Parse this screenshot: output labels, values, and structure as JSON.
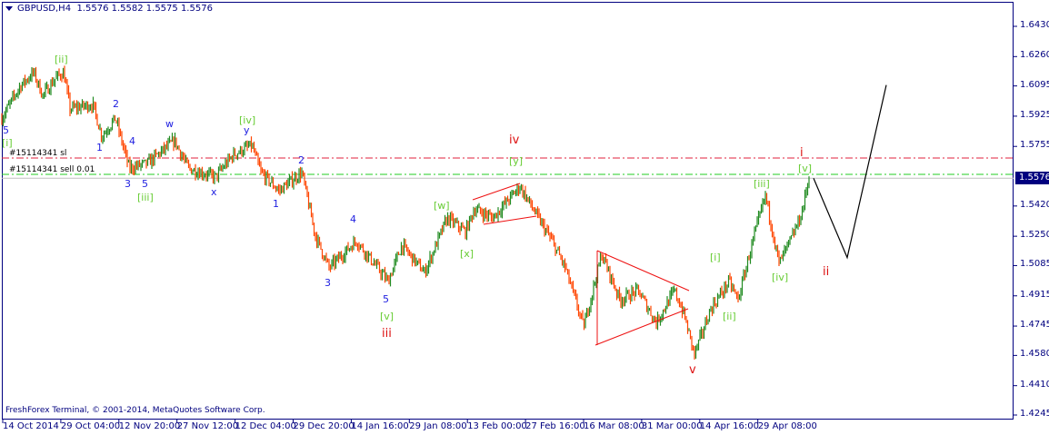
{
  "header": {
    "symbol": "GBPUSD,H4",
    "ohlc": "1.5576 1.5582 1.5575 1.5576"
  },
  "copyright": "FreshForex Terminal, © 2001-2014, MetaQuotes Software Corp.",
  "current_price": "1.5576",
  "orders": {
    "sl_label": "#15114341 sl",
    "sell_label": "#15114341 sell 0.01",
    "sl_price": 1.569,
    "sell_price": 1.5598
  },
  "y_axis": [
    "1.6430",
    "1.6260",
    "1.6095",
    "1.5925",
    "1.5755",
    "1.5420",
    "1.5250",
    "1.5085",
    "1.4915",
    "1.4745",
    "1.4580",
    "1.4410",
    "1.4245"
  ],
  "x_axis": [
    "14 Oct 2014",
    "29 Oct 04:00",
    "12 Nov 20:00",
    "27 Nov 12:00",
    "12 Dec 04:00",
    "29 Dec 20:00",
    "14 Jan 16:00",
    "29 Jan 08:00",
    "13 Feb 00:00",
    "27 Feb 16:00",
    "16 Mar 08:00",
    "31 Mar 00:00",
    "14 Apr 16:00",
    "29 Apr 08:00"
  ],
  "colors": {
    "up": "#228b22",
    "down": "#ff4500",
    "sl": "#e0203c",
    "sell": "#22cc22",
    "axis": "#00007f",
    "primary": "#dd1111",
    "minor": "#1e1ee0",
    "inter": "#66cc33"
  },
  "wave_labels": [
    {
      "t": "5",
      "c": "minor"
    },
    {
      "t": "[i]",
      "c": "inter"
    },
    {
      "t": "[ii]",
      "c": "inter"
    },
    {
      "t": "1",
      "c": "minor"
    },
    {
      "t": "2",
      "c": "minor"
    },
    {
      "t": "3",
      "c": "minor"
    },
    {
      "t": "4",
      "c": "minor"
    },
    {
      "t": "5",
      "c": "minor"
    },
    {
      "t": "[iii]",
      "c": "inter"
    },
    {
      "t": "w",
      "c": "minor"
    },
    {
      "t": "x",
      "c": "minor"
    },
    {
      "t": "y",
      "c": "minor"
    },
    {
      "t": "[iv]",
      "c": "inter"
    },
    {
      "t": "1",
      "c": "minor"
    },
    {
      "t": "2",
      "c": "minor"
    },
    {
      "t": "3",
      "c": "minor"
    },
    {
      "t": "4",
      "c": "minor"
    },
    {
      "t": "5",
      "c": "minor"
    },
    {
      "t": "[v]",
      "c": "inter"
    },
    {
      "t": "iii",
      "c": "primary"
    },
    {
      "t": "[w]",
      "c": "inter"
    },
    {
      "t": "[x]",
      "c": "inter"
    },
    {
      "t": "[y]",
      "c": "inter"
    },
    {
      "t": "iv",
      "c": "primary"
    },
    {
      "t": "v",
      "c": "primary"
    },
    {
      "t": "[i]",
      "c": "inter"
    },
    {
      "t": "[ii]",
      "c": "inter"
    },
    {
      "t": "[iii]",
      "c": "inter"
    },
    {
      "t": "[iv]",
      "c": "inter"
    },
    {
      "t": "[v]",
      "c": "inter"
    },
    {
      "t": "i",
      "c": "primary"
    },
    {
      "t": "ii",
      "c": "primary"
    }
  ],
  "chart_data": {
    "type": "candlestick",
    "symbol": "GBPUSD",
    "timeframe": "H4",
    "ylim": [
      1.4245,
      1.643
    ],
    "swing_path": [
      [
        0,
        1.5914
      ],
      [
        20,
        1.6093
      ],
      [
        35,
        1.617
      ],
      [
        45,
        1.6042
      ],
      [
        60,
        1.6144
      ],
      [
        68,
        1.617
      ],
      [
        75,
        1.5966
      ],
      [
        100,
        1.5991
      ],
      [
        110,
        1.5812
      ],
      [
        125,
        1.5914
      ],
      [
        140,
        1.5633
      ],
      [
        160,
        1.5659
      ],
      [
        190,
        1.5787
      ],
      [
        205,
        1.5633
      ],
      [
        235,
        1.5582
      ],
      [
        255,
        1.571
      ],
      [
        275,
        1.5761
      ],
      [
        285,
        1.5608
      ],
      [
        305,
        1.5506
      ],
      [
        330,
        1.5608
      ],
      [
        345,
        1.5251
      ],
      [
        360,
        1.5072
      ],
      [
        390,
        1.5225
      ],
      [
        425,
        1.4995
      ],
      [
        440,
        1.52
      ],
      [
        465,
        1.5046
      ],
      [
        490,
        1.5353
      ],
      [
        510,
        1.5276
      ],
      [
        520,
        1.5404
      ],
      [
        540,
        1.5353
      ],
      [
        570,
        1.5531
      ],
      [
        590,
        1.5353
      ],
      [
        605,
        1.5225
      ],
      [
        620,
        1.5072
      ],
      [
        640,
        1.474
      ],
      [
        660,
        1.5148
      ],
      [
        680,
        1.4893
      ],
      [
        700,
        1.4944
      ],
      [
        720,
        1.4765
      ],
      [
        740,
        1.4944
      ],
      [
        750,
        1.4817
      ],
      [
        762,
        1.4587
      ],
      [
        780,
        1.4842
      ],
      [
        800,
        1.4995
      ],
      [
        810,
        1.4893
      ],
      [
        825,
        1.52
      ],
      [
        840,
        1.548
      ],
      [
        855,
        1.5097
      ],
      [
        870,
        1.5251
      ],
      [
        880,
        1.5378
      ],
      [
        888,
        1.5583
      ]
    ],
    "projection": [
      [
        893,
        1.5576
      ],
      [
        930,
        1.513
      ],
      [
        973,
        1.61
      ]
    ]
  }
}
